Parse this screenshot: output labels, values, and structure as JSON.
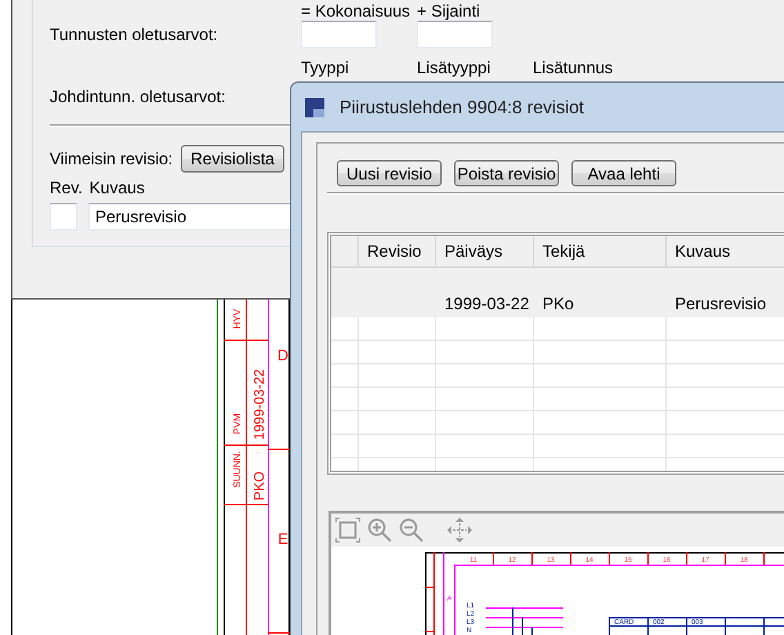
{
  "title_block": {
    "approved_label": "HYV",
    "date_label": "PVM",
    "designer_label": "SUUNN.",
    "date": "1999-03-22",
    "designer": "PKO",
    "zones": [
      "D",
      "E"
    ]
  },
  "settings_dialog": {
    "captions_top": [
      "= Kokonaisuus",
      "+ Sijainti"
    ],
    "tag_defaults_label": "Tunnusten oletusarvot:",
    "captions_type": [
      "Tyyppi",
      "Lisätyyppi",
      "Lisätunnus"
    ],
    "wire_tag_defaults_label": "Johdintunn. oletusarvot:",
    "latest_revision_label": "Viimeisin revisio:",
    "revision_list_button": "Revisiolista",
    "rev_label": "Rev.",
    "description_label": "Kuvaus",
    "description_value": "Perusrevisio"
  },
  "revisions_dialog": {
    "title": "Piirustuslehden 9904:8 revisiot",
    "buttons": [
      "Uusi revisio",
      "Poista revisio",
      "Avaa lehti"
    ],
    "table": {
      "columns": [
        "Revisio",
        "Päiväys",
        "Tekijä",
        "Kuvaus"
      ],
      "rows": [
        {
          "date": "1999-03-22",
          "author": "PKo",
          "description": "Perusrevisio"
        }
      ]
    },
    "preview": {
      "column_numbers": [
        "11",
        "12",
        "13",
        "14",
        "15",
        "16",
        "17",
        "18"
      ],
      "line_labels": [
        "L1",
        "L2",
        "L3",
        "N"
      ],
      "zone": "A",
      "table_cells": [
        "CARD",
        "002",
        "003"
      ]
    }
  }
}
